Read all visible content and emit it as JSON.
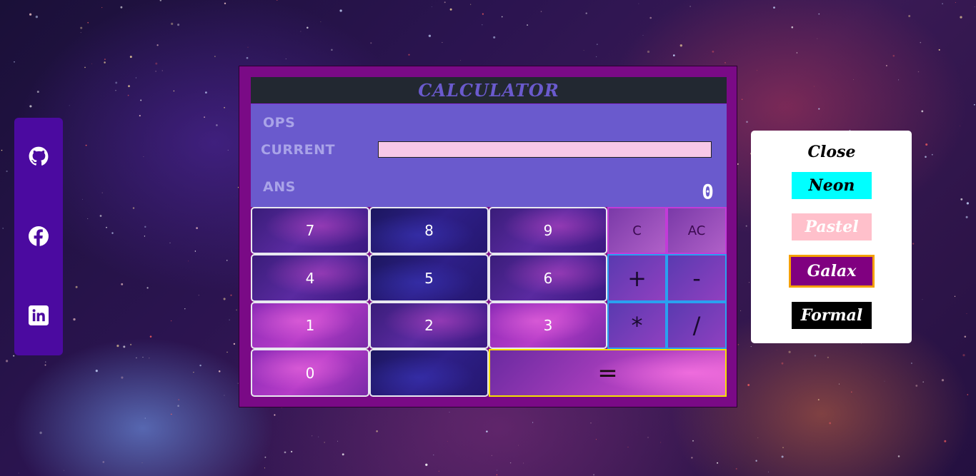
{
  "social": {
    "items": [
      {
        "icon": "github-icon"
      },
      {
        "icon": "facebook-icon"
      },
      {
        "icon": "linkedin-icon"
      }
    ]
  },
  "calculator": {
    "title": "CALCULATOR",
    "ops_label": "OPS",
    "current_label": "CURRENT",
    "current_value": "",
    "ans_label": "ANS",
    "ans_value": "0",
    "keys": {
      "k7": "7",
      "k8": "8",
      "k9": "9",
      "clear": "C",
      "all_clear": "AC",
      "k4": "4",
      "k5": "5",
      "k6": "6",
      "plus": "+",
      "minus": "-",
      "k1": "1",
      "k2": "2",
      "k3": "3",
      "multiply": "*",
      "divide": "/",
      "k0": "0",
      "dot": "",
      "equals": "="
    }
  },
  "themes": {
    "close_label": "Close",
    "neon": "Neon",
    "pastel": "Pastel",
    "galax": "Galax",
    "formal": "Formal",
    "selected": "Galax"
  },
  "colors": {
    "sidebar": "#4b0aa0",
    "calc_frame": "#7a0a86",
    "title_bar": "#222831",
    "display": "#6a5acd",
    "neon": "#00ffff",
    "pastel": "#ffc0cb",
    "galax": "#800080",
    "formal": "#000000",
    "selected_border": "#f5a000"
  }
}
